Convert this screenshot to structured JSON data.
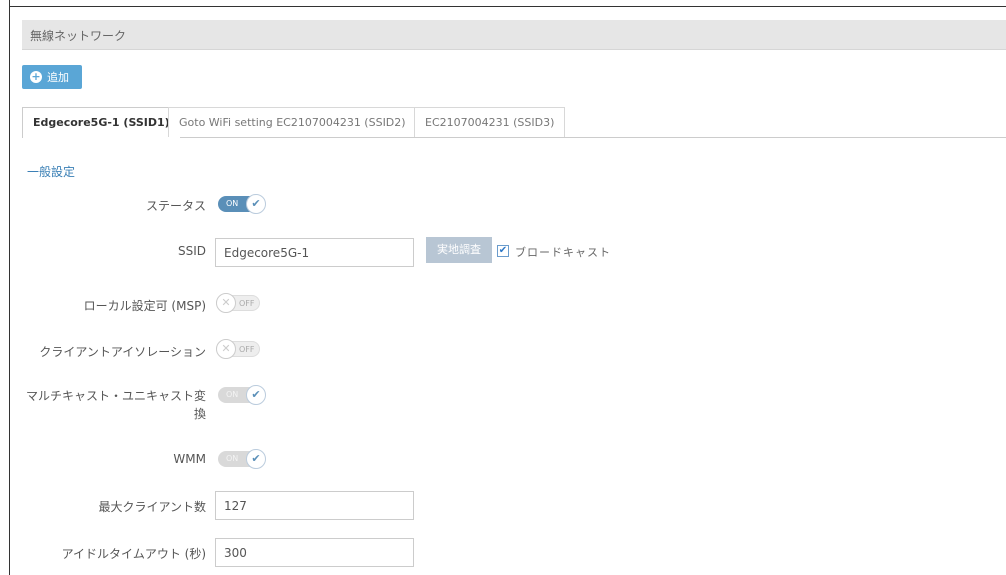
{
  "header": {
    "title": "無線ネットワーク"
  },
  "toolbar": {
    "add_label": "追加"
  },
  "tabs": [
    {
      "label": "Edgecore5G-1 (SSID1)",
      "active": true
    },
    {
      "label": "Goto WiFi setting EC2107004231 (SSID2)",
      "active": false
    },
    {
      "label": "EC2107004231 (SSID3)",
      "active": false
    }
  ],
  "section": {
    "title": "一般設定"
  },
  "form": {
    "status": {
      "label": "ステータス",
      "state": "ON"
    },
    "ssid": {
      "label": "SSID",
      "value": "Edgecore5G-1",
      "survey_label": "実地調査",
      "broadcast_label": "ブロードキャスト",
      "broadcast_checked": true
    },
    "local_config": {
      "label": "ローカル設定可 (MSP)",
      "state": "OFF"
    },
    "client_isolation": {
      "label": "クライアントアイソレーション",
      "state": "OFF"
    },
    "multicast": {
      "label_line1": "マルチキャスト・ユニキャスト変",
      "label_line2": "換",
      "state": "ON"
    },
    "wmm": {
      "label": "WMM",
      "state": "ON"
    },
    "max_clients": {
      "label": "最大クライアント数",
      "value": "127"
    },
    "idle_timeout": {
      "label": "アイドルタイムアウト (秒)",
      "value": "300"
    }
  },
  "colors": {
    "accent": "#5aa6d6",
    "toggle_on": "#5a8fb8",
    "section_title": "#3a7fb5"
  }
}
